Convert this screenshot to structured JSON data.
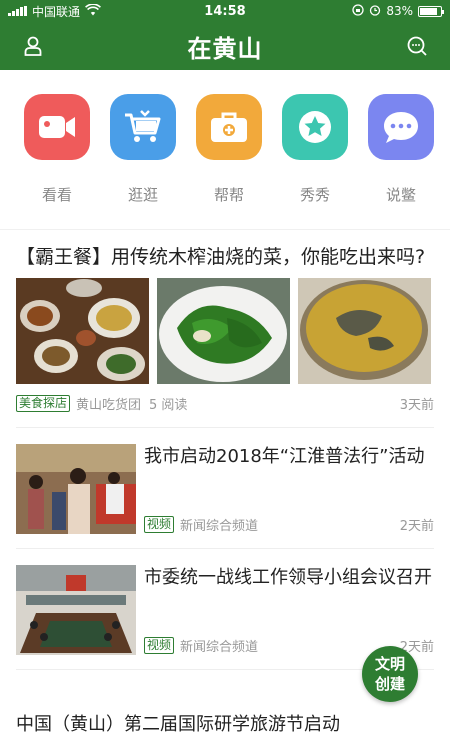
{
  "status_bar": {
    "carrier": "中国联通",
    "time": "14:58",
    "battery": "83%",
    "battery_level": 0.83
  },
  "header": {
    "title": "在黄山",
    "left_icon": "user-icon",
    "right_icon": "search-chat-icon"
  },
  "categories": [
    {
      "label": "看看",
      "icon": "video-camera-icon",
      "color": "#ef5b5b"
    },
    {
      "label": "逛逛",
      "icon": "shopping-cart-icon",
      "color": "#4a9ee8"
    },
    {
      "label": "帮帮",
      "icon": "medical-kit-icon",
      "color": "#f2a93b"
    },
    {
      "label": "秀秀",
      "icon": "star-icon",
      "color": "#3cc6b0"
    },
    {
      "label": "说鳖",
      "icon": "chat-bubble-icon",
      "color": "#7b86f0"
    }
  ],
  "feed": {
    "article1": {
      "title": "【霸王餐】用传统木榨油烧的菜，你能吃出来吗?",
      "tag": "美食探店",
      "source": "黄山吃货团",
      "reads": "5 阅读",
      "time": "3天前"
    },
    "article2": {
      "title": "我市启动2018年“江淮普法行”活动",
      "tag": "视频",
      "source": "新闻综合频道",
      "time": "2天前"
    },
    "article3": {
      "title": "市委统一战线工作领导小组会议召开",
      "tag": "视频",
      "source": "新闻综合频道",
      "time": "2天前"
    },
    "article4": {
      "title": "中国（黄山）第二届国际研学旅游节启动"
    }
  },
  "fab": {
    "line1": "文明",
    "line2": "创建"
  },
  "colors": {
    "brand_green": "#2e7d32"
  }
}
